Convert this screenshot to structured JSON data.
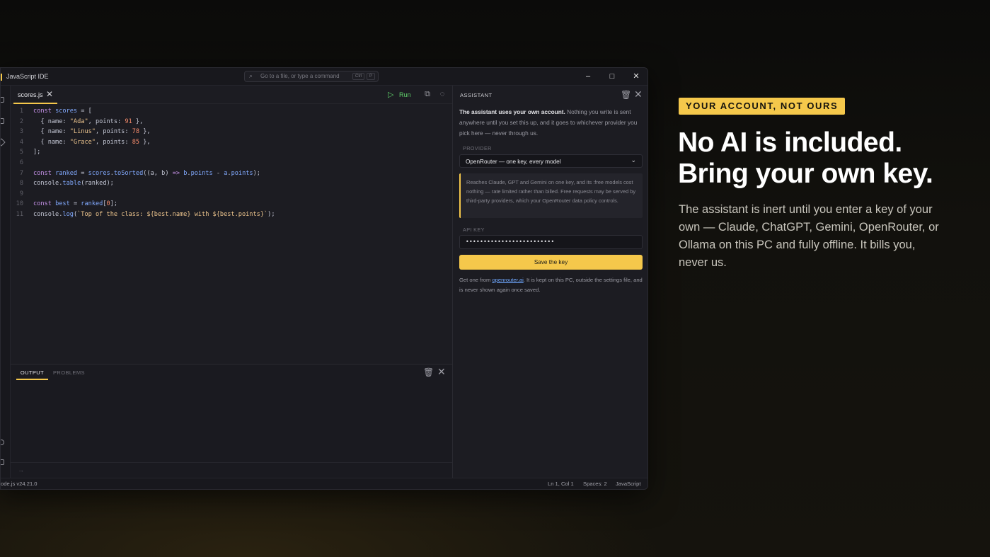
{
  "window": {
    "title": "JavaScript IDE",
    "command_placeholder": "Go to a file, or type a command",
    "shortcut": [
      "Ctrl",
      "P"
    ]
  },
  "editor": {
    "tab_label": "scores.js",
    "run_label": "Run",
    "line_numbers": [
      "1",
      "2",
      "3",
      "4",
      "5",
      "6",
      "7",
      "8",
      "9",
      "10",
      "11"
    ]
  },
  "panel": {
    "tabs": [
      "OUTPUT",
      "PROBLEMS"
    ],
    "prompt": "→"
  },
  "assistant": {
    "header": "ASSISTANT",
    "intro_bold": "The assistant uses your own account.",
    "intro_rest": " Nothing you write is sent anywhere until you set this up, and it goes to whichever provider you pick here — never through us.",
    "provider_label": "PROVIDER",
    "provider_value": "OpenRouter — one key, every model",
    "provider_note": "Reaches Claude, GPT and Gemini on one key, and its :free models cost nothing — rate limited rather than billed. Free requests may be served by third-party providers, which your OpenRouter data policy controls.",
    "api_key_label": "API KEY",
    "api_key_value": "•••••••••••••••••••••••••",
    "save_label": "Save the key",
    "foot_pre": "Get one from ",
    "foot_link": "openrouter.ai",
    "foot_post": ". It is kept on this PC, outside the settings file, and is never shown again once saved."
  },
  "status": {
    "left": "ode.js v24.21.0",
    "position": "Ln 1, Col 1",
    "spaces": "Spaces: 2",
    "language": "JavaScript"
  },
  "promo": {
    "badge": "YOUR ACCOUNT, NOT OURS",
    "headline_1": "No AI is included.",
    "headline_2": "Bring your own key.",
    "body": "The assistant is inert until you enter a key of your own — Claude, ChatGPT, Gemini, OpenRouter, or Ollama on this PC and fully offline. It bills you, never us."
  },
  "colors": {
    "accent": "#f5c84b",
    "run": "#5fcf6a",
    "link": "#6fa8ff"
  }
}
